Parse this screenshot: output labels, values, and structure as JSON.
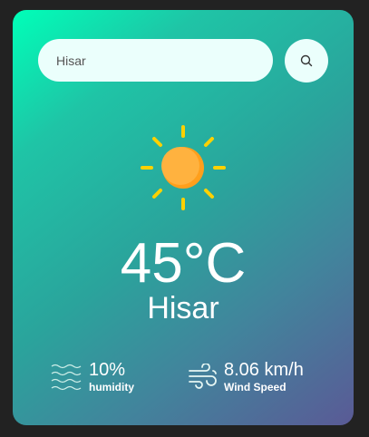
{
  "search": {
    "value": "Hisar",
    "icon": "search-icon"
  },
  "weather": {
    "icon": "sun-icon",
    "temperature": "45°C",
    "city": "Hisar"
  },
  "stats": {
    "humidity": {
      "value": "10%",
      "label": "humidity",
      "icon": "humidity-waves-icon"
    },
    "wind": {
      "value": "8.06 km/h",
      "label": "Wind Speed",
      "icon": "wind-icon"
    }
  },
  "colors": {
    "page_background": "#222222",
    "gradient_start": "#00ffb8",
    "gradient_end": "#5a5a96",
    "sun": "#ffb23f",
    "sun_rays": "#ffd100",
    "input_background": "#ebfffc"
  }
}
